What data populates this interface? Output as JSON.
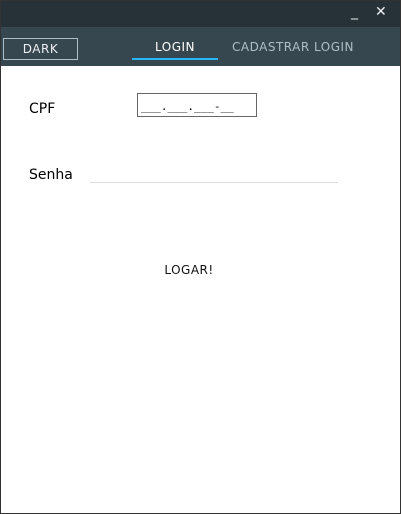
{
  "window": {
    "minimize": "_",
    "close": "✕"
  },
  "toolbar": {
    "dark_label": "DARK"
  },
  "tabs": [
    {
      "label": "LOGIN",
      "active": true
    },
    {
      "label": "CADASTRAR LOGIN",
      "active": false
    }
  ],
  "form": {
    "cpf_label": "CPF",
    "cpf_value": "___.___.___-__",
    "senha_label": "Senha",
    "senha_value": "",
    "submit_label": "LOGAR!"
  },
  "colors": {
    "titlebar": "#263238",
    "tabbar": "#37474f",
    "accent": "#29b6f6"
  }
}
